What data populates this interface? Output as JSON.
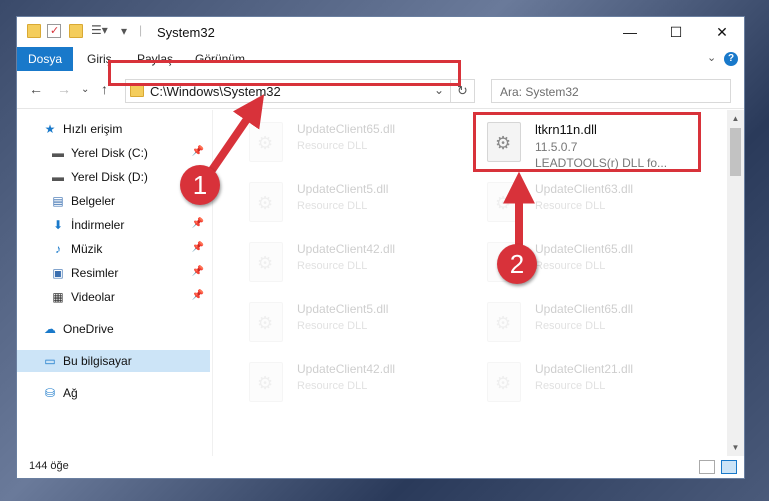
{
  "window": {
    "title": "System32",
    "controls": {
      "minimize": "—",
      "maximize": "☐",
      "close": "✕"
    }
  },
  "ribbon": {
    "tabs": [
      "Dosya",
      "Giriş",
      "Paylaş",
      "Görünüm"
    ],
    "expand": "⌄",
    "help": "?"
  },
  "nav": {
    "back": "←",
    "forward": "→",
    "recent": "⌄",
    "up": "↑",
    "address": "C:\\Windows\\System32",
    "search_placeholder": "Ara: System32"
  },
  "sidebar": {
    "items": [
      {
        "label": "Hızlı erişim",
        "icon": "star-icon",
        "glyph": "★",
        "color": "#1979ca",
        "pinned": false
      },
      {
        "label": "Yerel Disk (C:)",
        "icon": "drive-icon",
        "glyph": "▬",
        "color": "#555555",
        "pinned": true
      },
      {
        "label": "Yerel Disk (D:)",
        "icon": "drive-icon",
        "glyph": "▬",
        "color": "#555555",
        "pinned": true
      },
      {
        "label": "Belgeler",
        "icon": "documents-icon",
        "glyph": "▤",
        "color": "#3a6fb0",
        "pinned": true
      },
      {
        "label": "İndirmeler",
        "icon": "download-icon",
        "glyph": "⬇",
        "color": "#1979ca",
        "pinned": true
      },
      {
        "label": "Müzik",
        "icon": "music-icon",
        "glyph": "♪",
        "color": "#1979ca",
        "pinned": true
      },
      {
        "label": "Resimler",
        "icon": "pictures-icon",
        "glyph": "▣",
        "color": "#3a6fb0",
        "pinned": true
      },
      {
        "label": "Videolar",
        "icon": "videos-icon",
        "glyph": "▦",
        "color": "#333333",
        "pinned": true
      },
      {
        "label": "OneDrive",
        "icon": "cloud-icon",
        "glyph": "☁",
        "color": "#1979ca",
        "pinned": false
      },
      {
        "label": "Bu bilgisayar",
        "icon": "computer-icon",
        "glyph": "▭",
        "color": "#1979ca",
        "pinned": false
      },
      {
        "label": "Ağ",
        "icon": "network-icon",
        "glyph": "⛁",
        "color": "#1979ca",
        "pinned": false
      }
    ],
    "pin_glyph": "📌"
  },
  "files": [
    {
      "name": "UpdateClient65.dll",
      "desc": "Resource DLL",
      "faded": true
    },
    {
      "name": "ltkrn11n.dll",
      "version": "11.5.0.7",
      "desc": "LEADTOOLS(r) DLL fo...",
      "faded": false
    },
    {
      "name": "UpdateClient5.dll",
      "desc": "Resource DLL",
      "faded": true
    },
    {
      "name": "UpdateClient63.dll",
      "desc": "Resource DLL",
      "faded": true
    },
    {
      "name": "UpdateClient42.dll",
      "desc": "Resource DLL",
      "faded": true
    },
    {
      "name": "UpdateClient65.dll",
      "desc": "Resource DLL",
      "faded": true
    },
    {
      "name": "UpdateClient5.dll",
      "desc": "Resource DLL",
      "faded": true
    },
    {
      "name": "UpdateClient65.dll",
      "desc": "Resource DLL",
      "faded": true
    },
    {
      "name": "UpdateClient42.dll",
      "desc": "Resource DLL",
      "faded": true
    },
    {
      "name": "UpdateClient21.dll",
      "desc": "Resource DLL",
      "faded": true
    }
  ],
  "status": {
    "count": "144 öğe"
  },
  "annotations": {
    "step1": "1",
    "step2": "2",
    "color": "#d8323a"
  }
}
